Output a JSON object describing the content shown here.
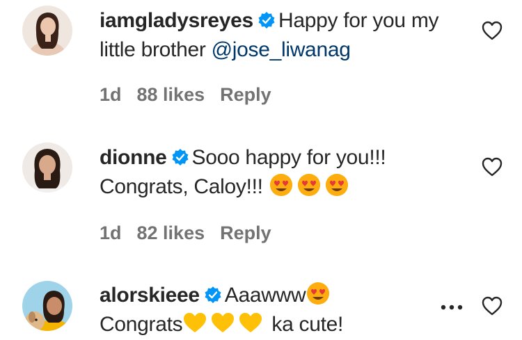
{
  "comments": [
    {
      "username": "iamgladysreyes",
      "text": "Happy for you my little brother",
      "mention": "@jose_liwanag",
      "time": "1d",
      "likes": "88 likes",
      "reply": "Reply",
      "verified": true,
      "avatar_icon": "woman-profile-photo"
    },
    {
      "username": "dionne",
      "text": "Sooo happy for you!!! Congrats, Caloy!!!",
      "emojis": [
        "heart-eyes-emoji",
        "heart-eyes-emoji",
        "heart-eyes-emoji"
      ],
      "time": "1d",
      "likes": "82 likes",
      "reply": "Reply",
      "verified": true,
      "avatar_icon": "woman-profile-photo"
    },
    {
      "username": "alorskieee",
      "text": "Aaawww",
      "text2": "Congrats",
      "text3": "ka cute!",
      "emojis": [
        "heart-eyes-emoji",
        "yellow-heart-emoji",
        "yellow-heart-emoji",
        "yellow-heart-emoji"
      ],
      "verified": true,
      "avatar_icon": "woman-with-dog-photo"
    }
  ],
  "colors": {
    "text": "#262626",
    "meta": "#737373",
    "mention": "#00376b",
    "verified": "#0095f6"
  }
}
